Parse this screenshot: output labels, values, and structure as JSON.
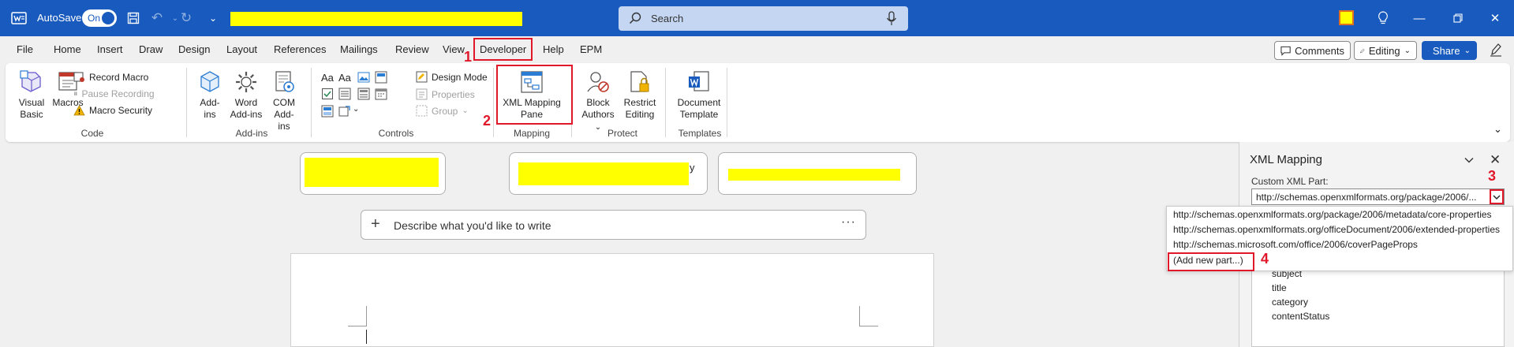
{
  "titlebar": {
    "autosave_label": "AutoSave",
    "autosave_state": "On",
    "search_placeholder": "Search"
  },
  "tabs": [
    "File",
    "Home",
    "Insert",
    "Draw",
    "Design",
    "Layout",
    "References",
    "Mailings",
    "Review",
    "View",
    "Developer",
    "Help",
    "EPM"
  ],
  "active_tab": "Developer",
  "right_controls": {
    "comments": "Comments",
    "editing": "Editing",
    "share": "Share"
  },
  "ribbon": {
    "code": {
      "visual_basic": "Visual Basic",
      "macros": "Macros",
      "record_macro": "Record Macro",
      "pause_recording": "Pause Recording",
      "macro_security": "Macro Security",
      "label": "Code"
    },
    "addins": {
      "addins": "Add-ins",
      "word_addins": "Word Add-ins",
      "com_addins": "COM Add-ins",
      "label": "Add-ins"
    },
    "controls": {
      "design_mode": "Design Mode",
      "properties": "Properties",
      "group": "Group",
      "label": "Controls"
    },
    "mapping": {
      "xml_mapping_pane": "XML Mapping Pane",
      "label": "Mapping"
    },
    "protect": {
      "block_authors": "Block Authors",
      "restrict_editing": "Restrict Editing",
      "label": "Protect"
    },
    "templates": {
      "document_template": "Document Template",
      "label": "Templates"
    }
  },
  "annotations": [
    "1",
    "2",
    "3",
    "4"
  ],
  "document": {
    "write_prompt": "Describe what you'd like to write",
    "card_fragment": "y"
  },
  "xml_pane": {
    "title": "XML Mapping",
    "custom_xml_part_label": "Custom XML Part:",
    "selected_part": "http://schemas.openxmlformats.org/package/2006/...",
    "dropdown_options": [
      "http://schemas.openxmlformats.org/package/2006/metadata/core-properties",
      "http://schemas.openxmlformats.org/officeDocument/2006/extended-properties",
      "http://schemas.microsoft.com/office/2006/coverPageProps",
      "(Add new part...)"
    ],
    "tree_items": [
      "subject",
      "title",
      "category",
      "contentStatus"
    ]
  },
  "colors": {
    "titlebar": "#185abd",
    "highlight_box": "#e0182a",
    "redaction": "#ffff00"
  }
}
